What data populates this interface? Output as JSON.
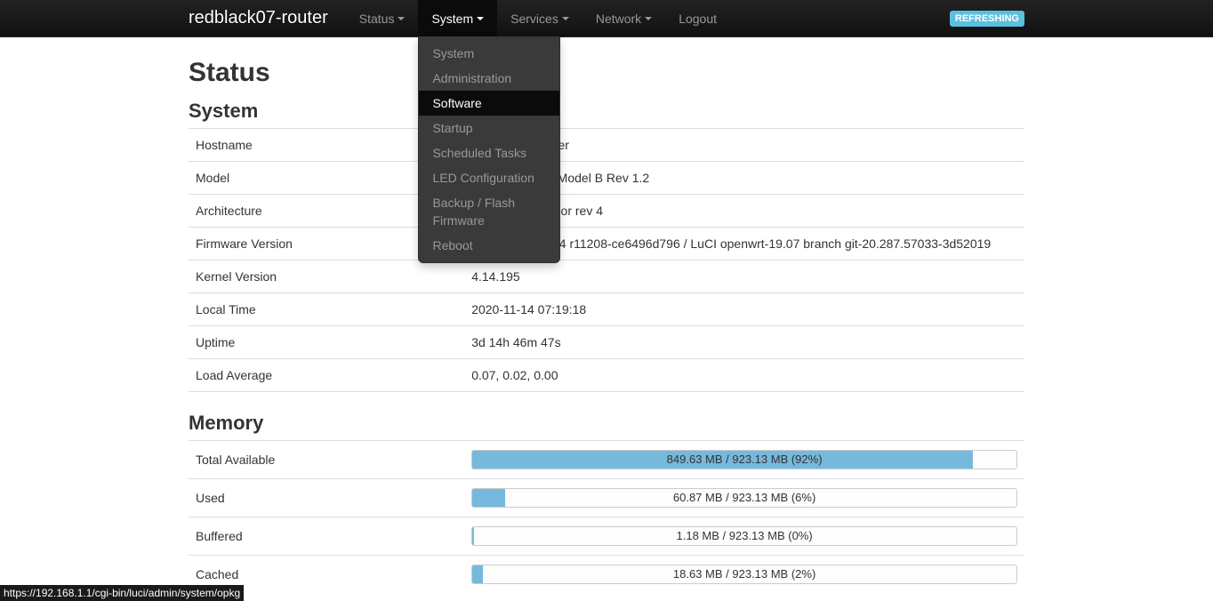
{
  "brand": "redblack07-router",
  "nav": {
    "status": "Status",
    "system": "System",
    "services": "Services",
    "network": "Network",
    "logout": "Logout"
  },
  "refresh_badge": "REFRESHING",
  "system_menu": {
    "system": "System",
    "administration": "Administration",
    "software": "Software",
    "startup": "Startup",
    "scheduled_tasks": "Scheduled Tasks",
    "led_config": "LED Configuration",
    "backup_flash": "Backup / Flash Firmware",
    "reboot": "Reboot"
  },
  "page": {
    "title": "Status",
    "section_system": "System",
    "section_memory": "Memory"
  },
  "system_rows": {
    "hostname_k": "Hostname",
    "hostname_v": "redblack07-router",
    "model_k": "Model",
    "model_v": "Raspberry Pi 3 Model B Rev 1.2",
    "arch_k": "Architecture",
    "arch_v": "ARMv8 Processor rev 4",
    "fw_k": "Firmware Version",
    "fw_v": "OpenWrt 19.07.4 r11208-ce6496d796 / LuCI openwrt-19.07 branch git-20.287.57033-3d52019",
    "kernel_k": "Kernel Version",
    "kernel_v": "4.14.195",
    "time_k": "Local Time",
    "time_v": "2020-11-14 07:19:18",
    "uptime_k": "Uptime",
    "uptime_v": "3d 14h 46m 47s",
    "load_k": "Load Average",
    "load_v": "0.07, 0.02, 0.00"
  },
  "memory_rows": {
    "total_k": "Total Available",
    "total_txt": "849.63 MB / 923.13 MB (92%)",
    "total_pct": "92",
    "used_k": "Used",
    "used_txt": "60.87 MB / 923.13 MB (6%)",
    "used_pct": "6",
    "buffered_k": "Buffered",
    "buffered_txt": "1.18 MB / 923.13 MB (0%)",
    "buffered_pct": "0.3",
    "cached_k": "Cached",
    "cached_txt": "18.63 MB / 923.13 MB (2%)",
    "cached_pct": "2"
  },
  "status_url": "https://192.168.1.1/cgi-bin/luci/admin/system/opkg"
}
